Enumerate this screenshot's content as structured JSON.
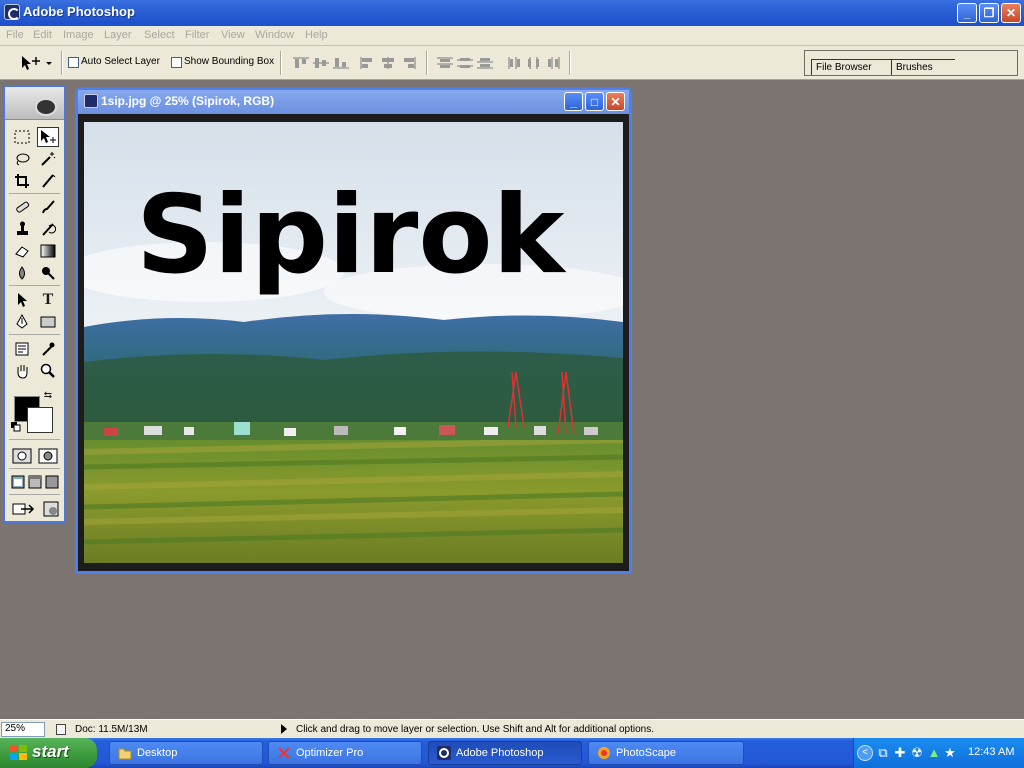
{
  "window": {
    "title": "Adobe Photoshop",
    "minimize": "_",
    "restore": "❐",
    "close": "✕"
  },
  "menu": [
    "File",
    "Edit",
    "Image",
    "Layer",
    "Select",
    "Filter",
    "View",
    "Window",
    "Help"
  ],
  "options_bar": {
    "auto_select_layer": {
      "label": "Auto Select Layer",
      "checked": false
    },
    "show_bounding_box": {
      "label": "Show Bounding Box",
      "checked": false
    },
    "palette_well_tabs": [
      "File Browser",
      "Brushes"
    ]
  },
  "toolbox": {
    "foreground_color": "#000000",
    "background_color": "#ffffff"
  },
  "document": {
    "title": "1sip.jpg @ 25% (Sipirok, RGB)",
    "text_layer": "Sipirok"
  },
  "status_bar": {
    "zoom": "25%",
    "doc_info": "Doc: 11.5M/13M",
    "hint": "Click and drag to move layer or selection.  Use Shift and Alt for additional options."
  },
  "taskbar": {
    "start_label": "start",
    "tasks": [
      {
        "label": "Desktop",
        "icon": "folder-icon"
      },
      {
        "label": "Optimizer Pro",
        "icon": "tools-icon"
      },
      {
        "label": "Adobe Photoshop",
        "icon": "photoshop-icon",
        "active": true
      },
      {
        "label": "PhotoScape",
        "icon": "photoscape-icon"
      }
    ],
    "clock": "12:43 AM"
  }
}
